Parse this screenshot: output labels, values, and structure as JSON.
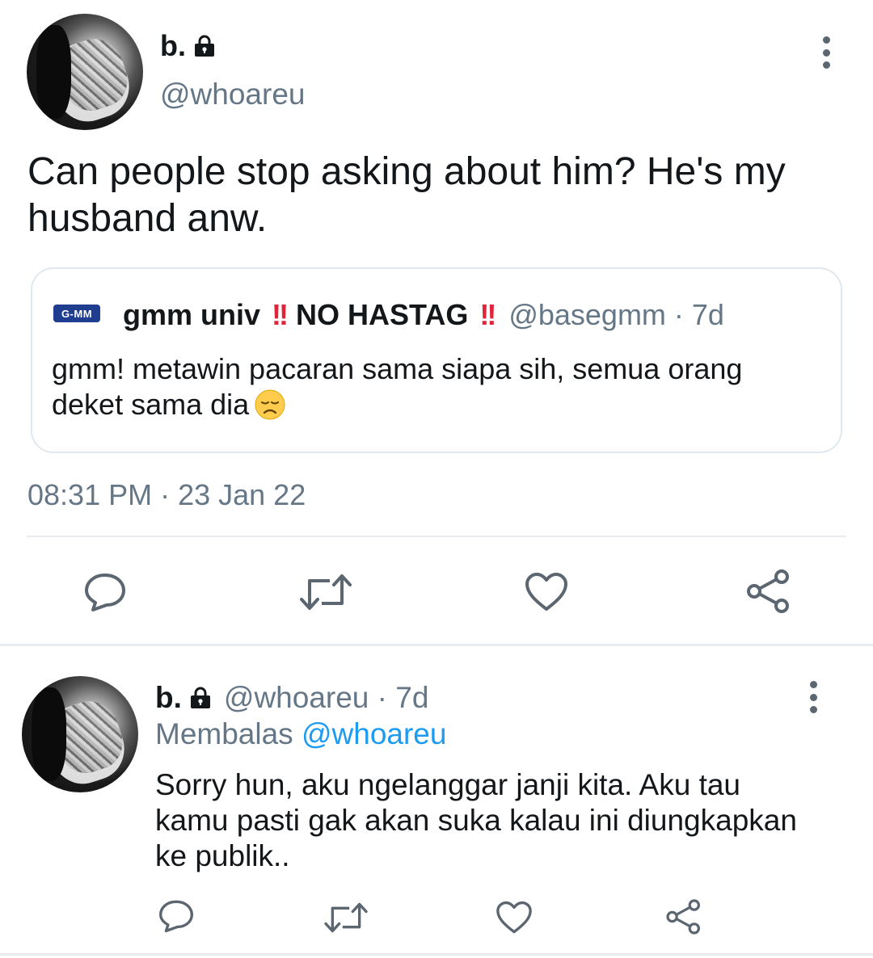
{
  "main_tweet": {
    "display_name": "b.",
    "handle": "@whoareu",
    "text": "Can people stop asking about him? He's my husband anw.",
    "timestamp": "08:31 PM · 23 Jan 22"
  },
  "quoted_tweet": {
    "logo_text": "G-MM",
    "display_name": "gmm univ",
    "bang_1": "!!",
    "middle_text": "NO HASTAG",
    "bang_2": "!!",
    "meta": "@basegmm · 7d",
    "text": "gmm! metawin pacaran sama siapa sih, semua orang deket sama dia"
  },
  "reply_tweet": {
    "display_name": "b.",
    "meta": "@whoareu · 7d",
    "replying_label": "Membalas",
    "replying_to": "@whoareu",
    "text": "Sorry hun, aku ngelanggar janji kita. Aku tau kamu pasti gak akan suka kalau ini diungkapkan ke publik.."
  },
  "icons": [
    "lock-icon",
    "more-icon",
    "reply-icon",
    "retweet-icon",
    "like-icon",
    "share-icon",
    "disappointed-emoji"
  ],
  "colors": {
    "text": "#14171a",
    "secondary": "#657786",
    "icon": "#5b6670",
    "link": "#1d9bf0",
    "border": "#e1e8ed",
    "alert": "#e0243a"
  }
}
